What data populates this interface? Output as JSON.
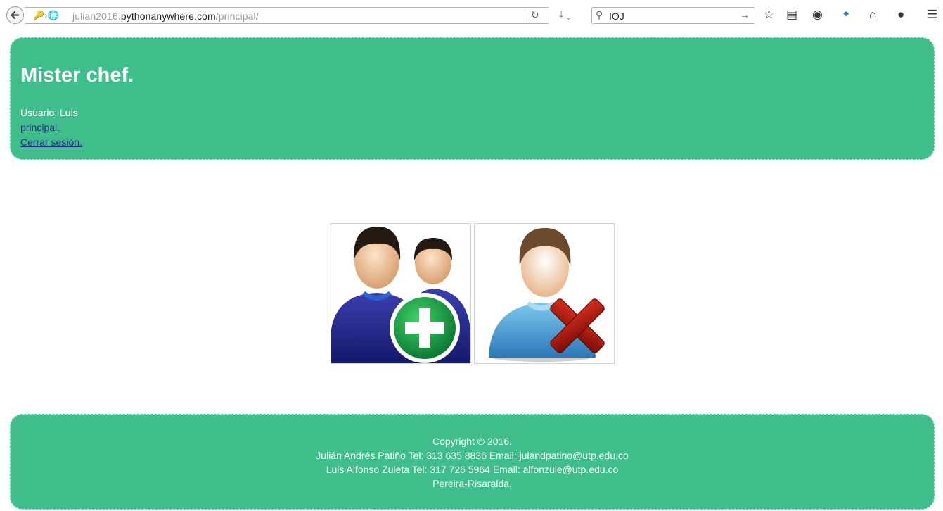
{
  "browser": {
    "url_prefix": "julian2016.",
    "url_domain": "pythonanywhere.com",
    "url_path": "/principal/",
    "search_value": "IOJ"
  },
  "header": {
    "title": "Mister chef.",
    "user_label": "Usuario: Luis",
    "link_principal": "principal.",
    "link_logout": "Cerrar sesión."
  },
  "footer": {
    "copyright": "Copyright © 2016.",
    "contact_1": "Julián Andrés Patiño Tel: 313 635 8836 Email: julandpatino@utp.edu.co",
    "contact_2": "Luis Alfonso Zuleta Tel: 317 726 5964 Email: alfonzule@utp.edu.co",
    "location": "Pereira-Risaralda."
  },
  "icons": {
    "add": "add-users-icon",
    "remove": "remove-user-icon"
  },
  "colors": {
    "panel": "#3fbd8a",
    "link": "#2a2a8c"
  }
}
